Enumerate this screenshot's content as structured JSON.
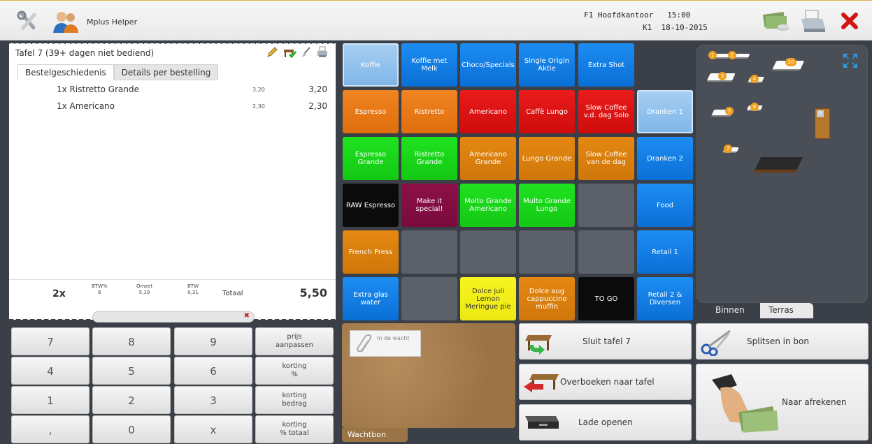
{
  "topbar": {
    "app_name": "Mplus Helper",
    "location": "F1 Hoofdkantoor",
    "time": "15:00",
    "register": "K1",
    "date": "18-10-2015",
    "icons": [
      "tools-icon",
      "users-icon",
      "cash-icon",
      "printer-icon",
      "close-icon"
    ]
  },
  "order": {
    "title": "Tafel 7  (39+ dagen niet bediend)",
    "tabs": [
      "Bestelgeschiedenis",
      "Details per bestelling"
    ],
    "lines": [
      {
        "desc": "1x Ristretto Grande",
        "unit": "3,20",
        "amount": "3,20"
      },
      {
        "desc": "1x Americano",
        "unit": "2,30",
        "amount": "2,30"
      }
    ],
    "totals": {
      "qty": "2x",
      "btw_pct_label": "BTW%",
      "btw_pct": "6",
      "omzet_label": "Omzet",
      "omzet": "5,19",
      "btw_label": "BTW",
      "btw": "0,31",
      "total_label": "Totaal",
      "total": "5,50"
    }
  },
  "numpad": {
    "keys": [
      "7",
      "8",
      "9",
      "4",
      "5",
      "6",
      "1",
      "2",
      "3",
      ",",
      "0",
      "x"
    ],
    "fn": [
      "prijs\naanpassen",
      "korting\n%",
      "korting\nbedrag",
      "korting\n% totaal"
    ]
  },
  "products": [
    {
      "label": "Koffie",
      "color": "lblue"
    },
    {
      "label": "Koffie met Melk",
      "color": "blue"
    },
    {
      "label": "Choco/Specials",
      "color": "blue"
    },
    {
      "label": "Single Origin Aktie",
      "color": "blue"
    },
    {
      "label": "Extra Shot",
      "color": "blue"
    },
    {
      "label": "Espresso",
      "color": "orange"
    },
    {
      "label": "Ristretto",
      "color": "orange"
    },
    {
      "label": "Americano",
      "color": "red"
    },
    {
      "label": "Caffè Lungo",
      "color": "red"
    },
    {
      "label": "Slow Coffee v.d. dag Solo",
      "color": "red"
    },
    {
      "label": "Espresso Grande",
      "color": "green"
    },
    {
      "label": "Ristretto Grande",
      "color": "green"
    },
    {
      "label": "Americano Grande",
      "color": "darkor"
    },
    {
      "label": "Lungo Grande",
      "color": "darkor"
    },
    {
      "label": "Slow Coffee van de dag",
      "color": "darkor"
    },
    {
      "label": "RAW Espresso",
      "color": "black"
    },
    {
      "label": "Make it special!",
      "color": "maroon"
    },
    {
      "label": "Molto Grande Americano",
      "color": "green"
    },
    {
      "label": "Multo Grande Lungo",
      "color": "green"
    },
    {
      "label": "",
      "color": "empty"
    },
    {
      "label": "French Press",
      "color": "darkor"
    },
    {
      "label": "",
      "color": "empty"
    },
    {
      "label": "",
      "color": "empty"
    },
    {
      "label": "",
      "color": "empty"
    },
    {
      "label": "",
      "color": "empty"
    },
    {
      "label": "Extra glas water",
      "color": "blue"
    },
    {
      "label": "",
      "color": "empty"
    },
    {
      "label": "Dolce juli Lemon Meringue pie",
      "color": "yellow"
    },
    {
      "label": "Dolce aug cappuccino muffin",
      "color": "darkor"
    },
    {
      "label": "TO GO",
      "color": "black"
    }
  ],
  "categories": [
    {
      "label": "Dranken 1",
      "color": "lblue"
    },
    {
      "label": "Dranken 2",
      "color": "blue"
    },
    {
      "label": "Food",
      "color": "blue"
    },
    {
      "label": "Retail 1",
      "color": "blue"
    },
    {
      "label": "Retail 2 & Diversen",
      "color": "blue"
    }
  ],
  "floor": {
    "tabs": [
      "Binnen",
      "Terras"
    ],
    "tables": [
      "1",
      "2",
      "3",
      "4",
      "5",
      "6",
      "7",
      "20"
    ],
    "door_label": "B"
  },
  "wait": {
    "card_label": "In de wacht",
    "area_label": "Wachtbon"
  },
  "actions": {
    "close_table": "Sluit tafel 7",
    "split": "Splitsen in bon",
    "transfer": "Overboeken naar tafel",
    "drawer": "Lade openen",
    "checkout": "Naar afrekenen"
  }
}
